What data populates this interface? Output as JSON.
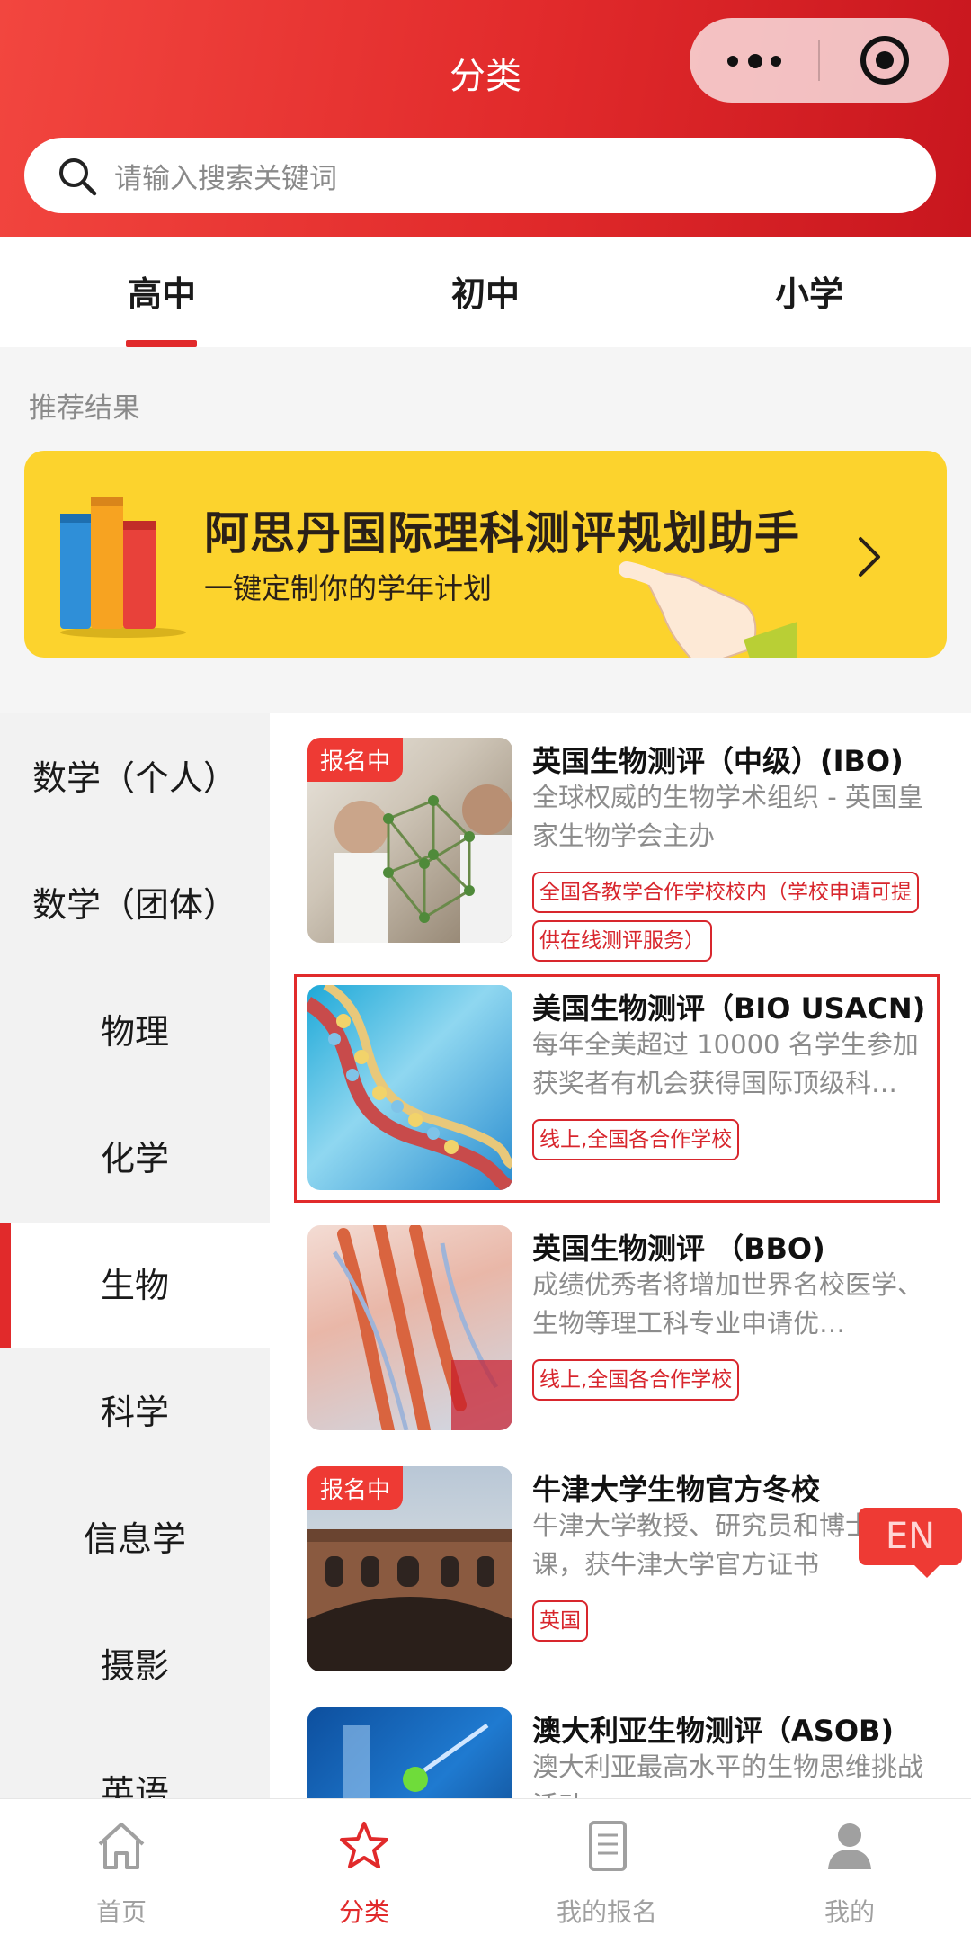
{
  "header": {
    "title": "分类",
    "search_placeholder": "请输入搜索关键词"
  },
  "level_tabs": [
    {
      "label": "高中",
      "active": true
    },
    {
      "label": "初中",
      "active": false
    },
    {
      "label": "小学",
      "active": false
    }
  ],
  "recommend_label": "推荐结果",
  "banner": {
    "title": "阿思丹国际理科测评规划助手",
    "subtitle": "一键定制你的学年计划"
  },
  "categories": [
    {
      "label": "数学（个人）",
      "active": false
    },
    {
      "label": "数学（团体）",
      "active": false
    },
    {
      "label": "物理",
      "active": false
    },
    {
      "label": "化学",
      "active": false
    },
    {
      "label": "生物",
      "active": true
    },
    {
      "label": "科学",
      "active": false
    },
    {
      "label": "信息学",
      "active": false
    },
    {
      "label": "摄影",
      "active": false
    },
    {
      "label": "英语",
      "active": false
    }
  ],
  "courses": [
    {
      "title": "英国生物测评（中级）(IBO)",
      "badge": "报名中",
      "desc": "全球权威的生物学术组织 - 英国皇家生物学会主办",
      "tags": [
        "全国各教学合作学校校内（学校申请可提",
        "供在线测评服务）"
      ]
    },
    {
      "title": "美国生物测评（BIO USACN)",
      "badge": "",
      "desc": "每年全美超过 10000 名学生参加获奖者有机会获得国际顶级科…",
      "tags": [
        "线上,全国各合作学校"
      ]
    },
    {
      "title": "英国生物测评 （BBO)",
      "badge": "",
      "desc": "成绩优秀者将增加世界名校医学、生物等理工科专业申请优…",
      "tags": [
        "线上,全国各合作学校"
      ]
    },
    {
      "title": "牛津大学生物官方冬校",
      "badge": "报名中",
      "desc": "牛津大学教授、研究员和博士授课，获牛津大学官方证书",
      "tags": [
        "英国"
      ]
    },
    {
      "title": "澳大利亚生物测评（ASOB)",
      "badge": "",
      "desc": "澳大利亚最高水平的生物思维挑战活动",
      "tags": []
    }
  ],
  "floating_lang": "EN",
  "bottom_tabs": [
    {
      "label": "首页",
      "icon": "home-icon",
      "active": false
    },
    {
      "label": "分类",
      "icon": "star-icon",
      "active": true
    },
    {
      "label": "我的报名",
      "icon": "document-icon",
      "active": false
    },
    {
      "label": "我的",
      "icon": "user-icon",
      "active": false
    }
  ],
  "colors": {
    "brand_red": "#e12a2b",
    "banner_yellow": "#fcd32d"
  }
}
